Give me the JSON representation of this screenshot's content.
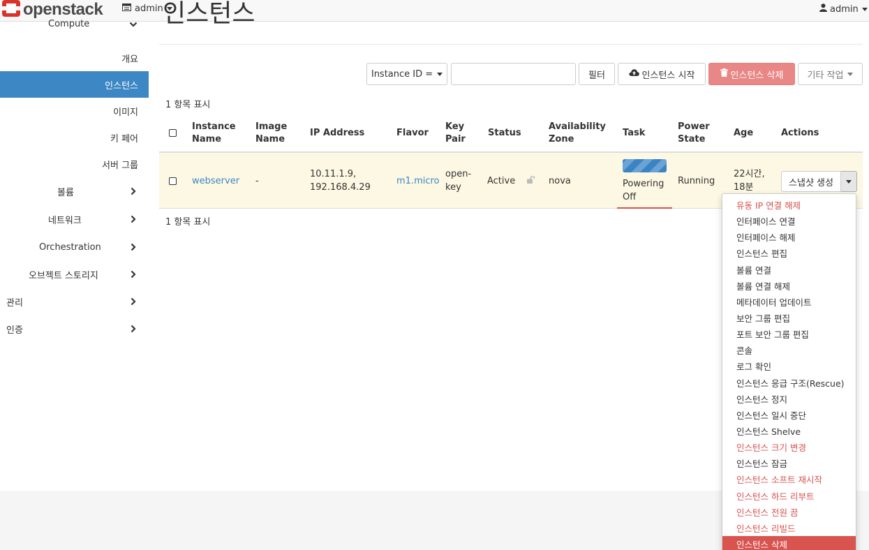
{
  "navbar": {
    "brand": "openstack",
    "project": "admin",
    "user": "admin"
  },
  "page": {
    "title": "인스턴스"
  },
  "sidebar": {
    "items": [
      {
        "label": "Compute",
        "chevron": "down"
      },
      {
        "label": "개요"
      },
      {
        "label": "인스턴스",
        "active": true
      },
      {
        "label": "이미지"
      },
      {
        "label": "키 페어"
      },
      {
        "label": "서버 그룹"
      },
      {
        "label": "볼륨",
        "chevron": "right"
      },
      {
        "label": "네트워크",
        "chevron": "right"
      },
      {
        "label": "Orchestration",
        "chevron": "right"
      },
      {
        "label": "오브젝트 스토리지",
        "chevron": "right"
      },
      {
        "label": "관리",
        "chevron": "right"
      },
      {
        "label": "인증",
        "chevron": "right"
      }
    ]
  },
  "toolbar": {
    "filter_field": "Instance ID =",
    "filter_value": "",
    "filter_button": "필터",
    "launch_button": "인스턴스 시작",
    "delete_button": "인스턴스 삭제",
    "more_button": "기타 작업"
  },
  "table": {
    "count_top": "1 항목 표시",
    "count_bottom": "1 항목 표시",
    "headers": {
      "name": [
        "Instance",
        "Name"
      ],
      "image": [
        "Image",
        "Name"
      ],
      "ip": "IP Address",
      "flavor": "Flavor",
      "keypair": [
        "Key",
        "Pair"
      ],
      "status": "Status",
      "zone": [
        "Availability",
        "Zone"
      ],
      "task": "Task",
      "power": [
        "Power",
        "State"
      ],
      "age": "Age",
      "actions": "Actions"
    },
    "row": {
      "name": "webserver",
      "image": "-",
      "ip": [
        "10.11.1.9,",
        "192.168.4.29"
      ],
      "flavor": "m1.micro",
      "keypair": [
        "open-",
        "key"
      ],
      "status": "Active",
      "zone": "nova",
      "task": [
        "Powering",
        "Off"
      ],
      "power": "Running",
      "age": [
        "22시간,",
        "18분"
      ],
      "action_button": "스냅샷 생성"
    }
  },
  "actions_menu": [
    {
      "label": "유동 IP 연결 해제",
      "style": "danger"
    },
    {
      "label": "인터페이스 연결",
      "style": "normal"
    },
    {
      "label": "인터페이스 해제",
      "style": "normal"
    },
    {
      "label": "인스턴스 편집",
      "style": "normal"
    },
    {
      "label": "볼륨 연결",
      "style": "normal"
    },
    {
      "label": "볼륨 연결 해제",
      "style": "normal"
    },
    {
      "label": "메타데이터 업데이트",
      "style": "normal"
    },
    {
      "label": "보안 그룹 편집",
      "style": "normal"
    },
    {
      "label": "포트 보안 그룹 편집",
      "style": "normal"
    },
    {
      "label": "콘솔",
      "style": "normal"
    },
    {
      "label": "로그 확인",
      "style": "normal"
    },
    {
      "label": "인스턴스 응급 구조(Rescue)",
      "style": "normal"
    },
    {
      "label": "인스턴스 정지",
      "style": "normal"
    },
    {
      "label": "인스턴스 일시 중단",
      "style": "normal"
    },
    {
      "label": "인스턴스 Shelve",
      "style": "normal"
    },
    {
      "label": "인스턴스 크기 변경",
      "style": "danger"
    },
    {
      "label": "인스턴스 잠금",
      "style": "normal"
    },
    {
      "label": "인스턴스 소프트 재시작",
      "style": "danger"
    },
    {
      "label": "인스턴스 하드 리부트",
      "style": "danger"
    },
    {
      "label": "인스턴스 전원 끔",
      "style": "danger"
    },
    {
      "label": "인스턴스 리빌드",
      "style": "danger"
    },
    {
      "label": "인스턴스 삭제",
      "style": "highlight"
    }
  ],
  "colors": {
    "accent": "#3c87c4",
    "link": "#3a87c5",
    "danger": "#d9534f",
    "row_highlight": "#fcf8e3",
    "brand_red": "#d9332b"
  },
  "icons": {
    "brand": "openstack-logo-icon",
    "project": "project-icon",
    "user": "user-icon",
    "launch": "cloud-upload-icon",
    "delete": "trash-icon",
    "lock": "unlock-icon"
  }
}
